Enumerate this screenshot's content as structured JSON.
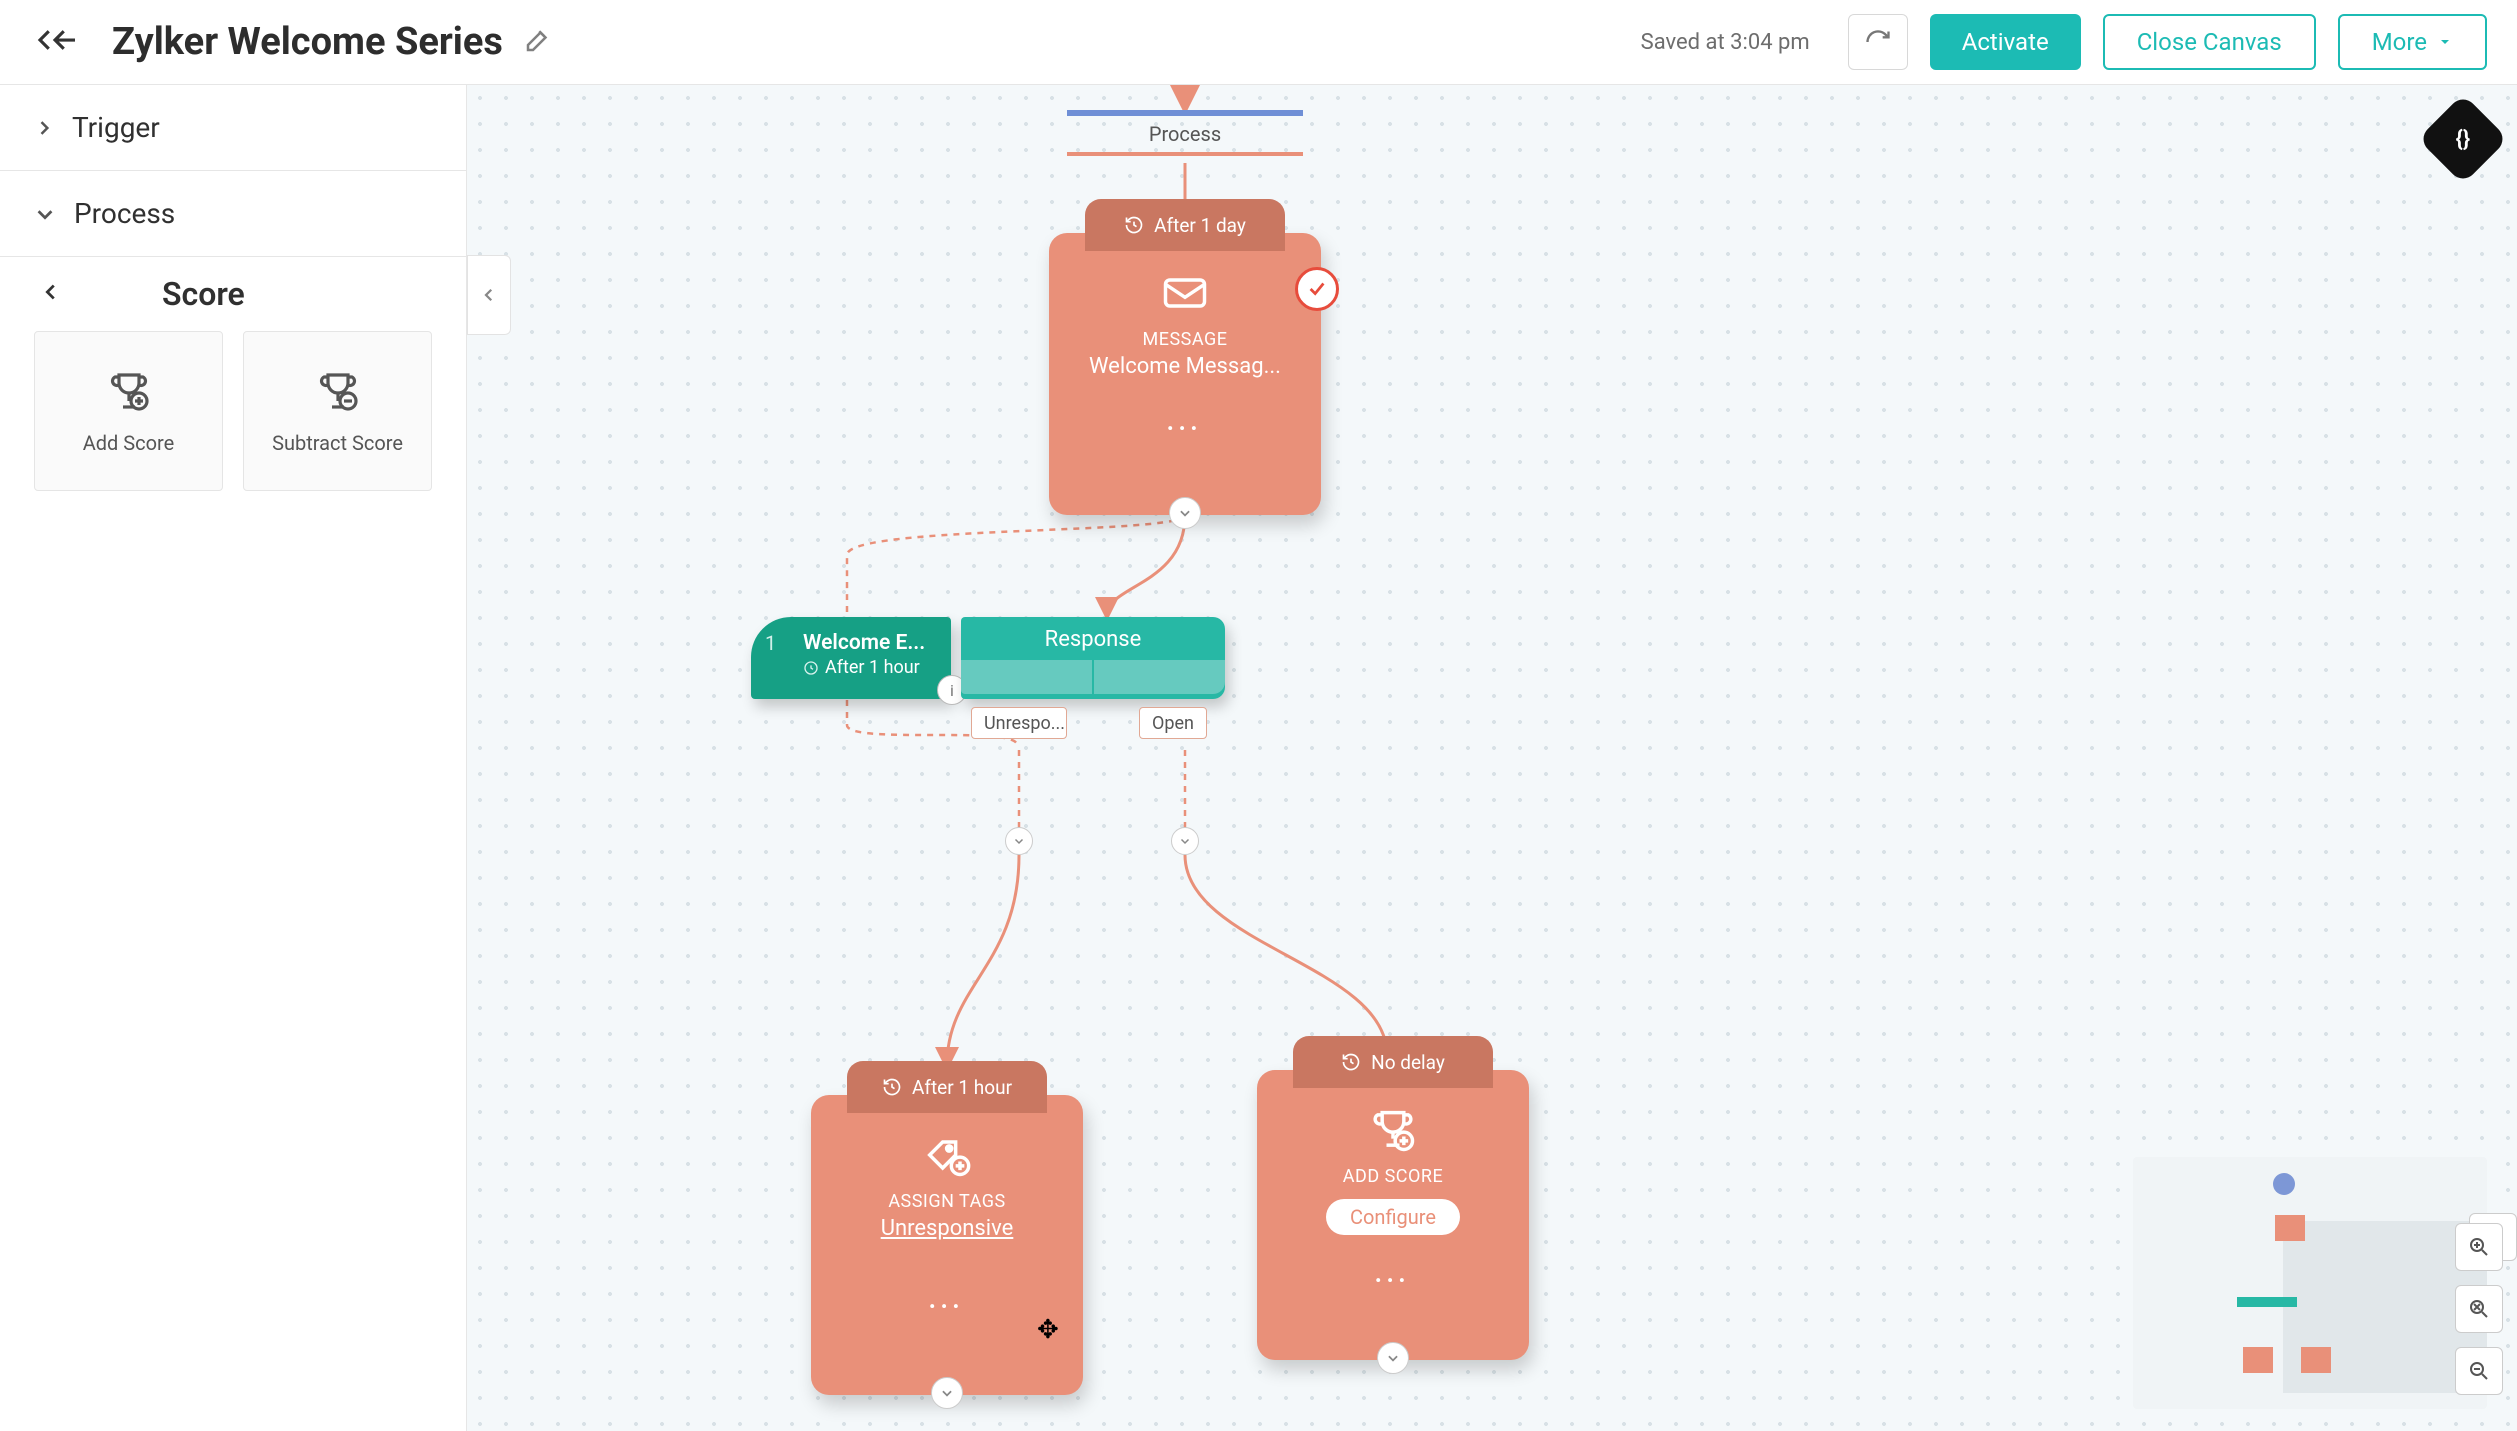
{
  "header": {
    "title": "Zylker Welcome Series",
    "saved": "Saved at 3:04 pm",
    "activate": "Activate",
    "close": "Close Canvas",
    "more": "More"
  },
  "sidebar": {
    "trigger": "Trigger",
    "process": "Process",
    "score_title": "Score",
    "palette": {
      "add": "Add Score",
      "subtract": "Subtract Score"
    }
  },
  "flow": {
    "process_label": "Process",
    "message": {
      "delay": "After 1 day",
      "type": "MESSAGE",
      "subject": "Welcome Messag..."
    },
    "split": {
      "idx": "1",
      "criteria_title": "Welcome E...",
      "criteria_time": "After 1 hour",
      "response": "Response",
      "branch_unresp": "Unrespo...",
      "branch_open": "Open"
    },
    "tags": {
      "delay": "After 1 hour",
      "type": "ASSIGN TAGS",
      "value": "Unresponsive"
    },
    "score": {
      "delay": "No delay",
      "type": "ADD SCORE",
      "configure": "Configure"
    }
  }
}
